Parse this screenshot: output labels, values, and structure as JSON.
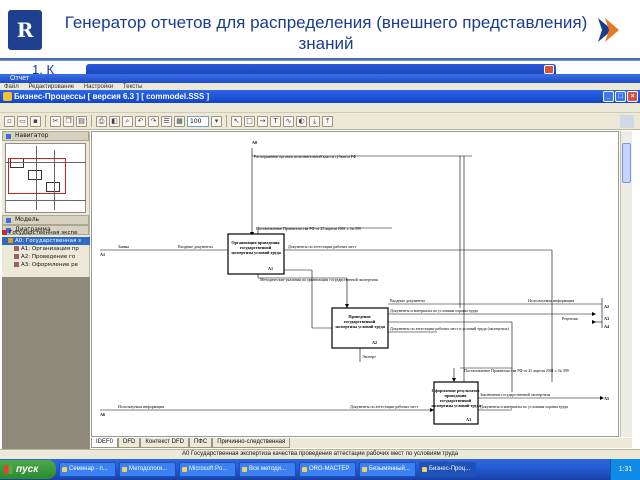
{
  "slide": {
    "title": "Генератор отчетов для распределения (внешнего представления) знаний",
    "bullet_stub": "1. К"
  },
  "report_window": {
    "title": "Отчет",
    "menu": [
      "Файл",
      "Редактирование",
      "Настройки",
      "Тексты"
    ]
  },
  "app": {
    "title": "Бизнес-Процессы [ версия 6.3 ] [ commodel.SSS ]",
    "zoom": "100"
  },
  "navigator": {
    "header": "Навигатор",
    "model_label": "Модель",
    "diagram_label": "Диаграмма",
    "tree": [
      "Государственная экспе",
      "А0: Государственная з",
      "А1: Организация пр",
      "А2: Проведение го",
      "А3: Оформление ре"
    ]
  },
  "diagram": {
    "node_labels": {
      "a0": "А0",
      "a1": "А1",
      "a2": "А2",
      "a3": "А3",
      "a4": "А4",
      "a5": "А5",
      "a6": "А6",
      "a7": "А7",
      "a8": "А8",
      "a9": "А9",
      "a10": "А10",
      "a11": "А11"
    },
    "boxes": [
      {
        "title": "Организация проведения государственной экспертизы условий труда",
        "num": "А1"
      },
      {
        "title": "Проведение государственной экспертизы условий труда",
        "num": "А2"
      },
      {
        "title": "Оформление результатов проведения государственной экспертизы условий труда",
        "num": "А3"
      }
    ],
    "arrows": {
      "top1": "Распоряжение органов исполнительной власти субъекта РФ",
      "postanovlenie1": "Постановление Правительства РФ от 25 апреля 2001 г. № 399",
      "zayavka": "Заявка",
      "vhodnye1": "Входные документы",
      "doc_att1": "Документы по аттестации рабочих мест",
      "metod1": "Методические указания по организации государственной экспертизы",
      "vhodnye2": "Входные документы",
      "ispolz_inf": "Используемая информация",
      "recenz": "Рецензия",
      "dok_inf": "Документы и материалы по условиям охраны труда",
      "doc_att2": "Документы по аттестации рабочих мест и условий труда (экспертиза)",
      "expert": "Эксперт",
      "postanovlenie2": "Постановление Правительства РФ от 25 апреля 2001 г. № 399",
      "zakl": "Заключение государственной экспертизы",
      "dok_otchet": "Документы и материалы по условиям охраны труда",
      "ispolz_inf2": "Используемая информация",
      "doc_att3": "Документы по аттестации рабочих мест"
    }
  },
  "tabs": [
    "IDEF0",
    "DFD",
    "Контекст DFD",
    "ПФС",
    "Причинно-следственная"
  ],
  "status": "А0 Государственная экспертиза качества проведения аттестации рабочих мест по условиям труда",
  "taskbar": {
    "start": "пуск",
    "tasks": [
      "Семинар - п...",
      "Методологи...",
      "Microsoft Po...",
      "Все методи...",
      "ORG-МАСТЕР",
      "Безымянный...",
      "Бизнес-Проц..."
    ],
    "clock": "1:31"
  },
  "colors": {
    "title_blue": "#1a3b8f",
    "xp_blue": "#245dd6",
    "nav_orange": "#e87722"
  }
}
